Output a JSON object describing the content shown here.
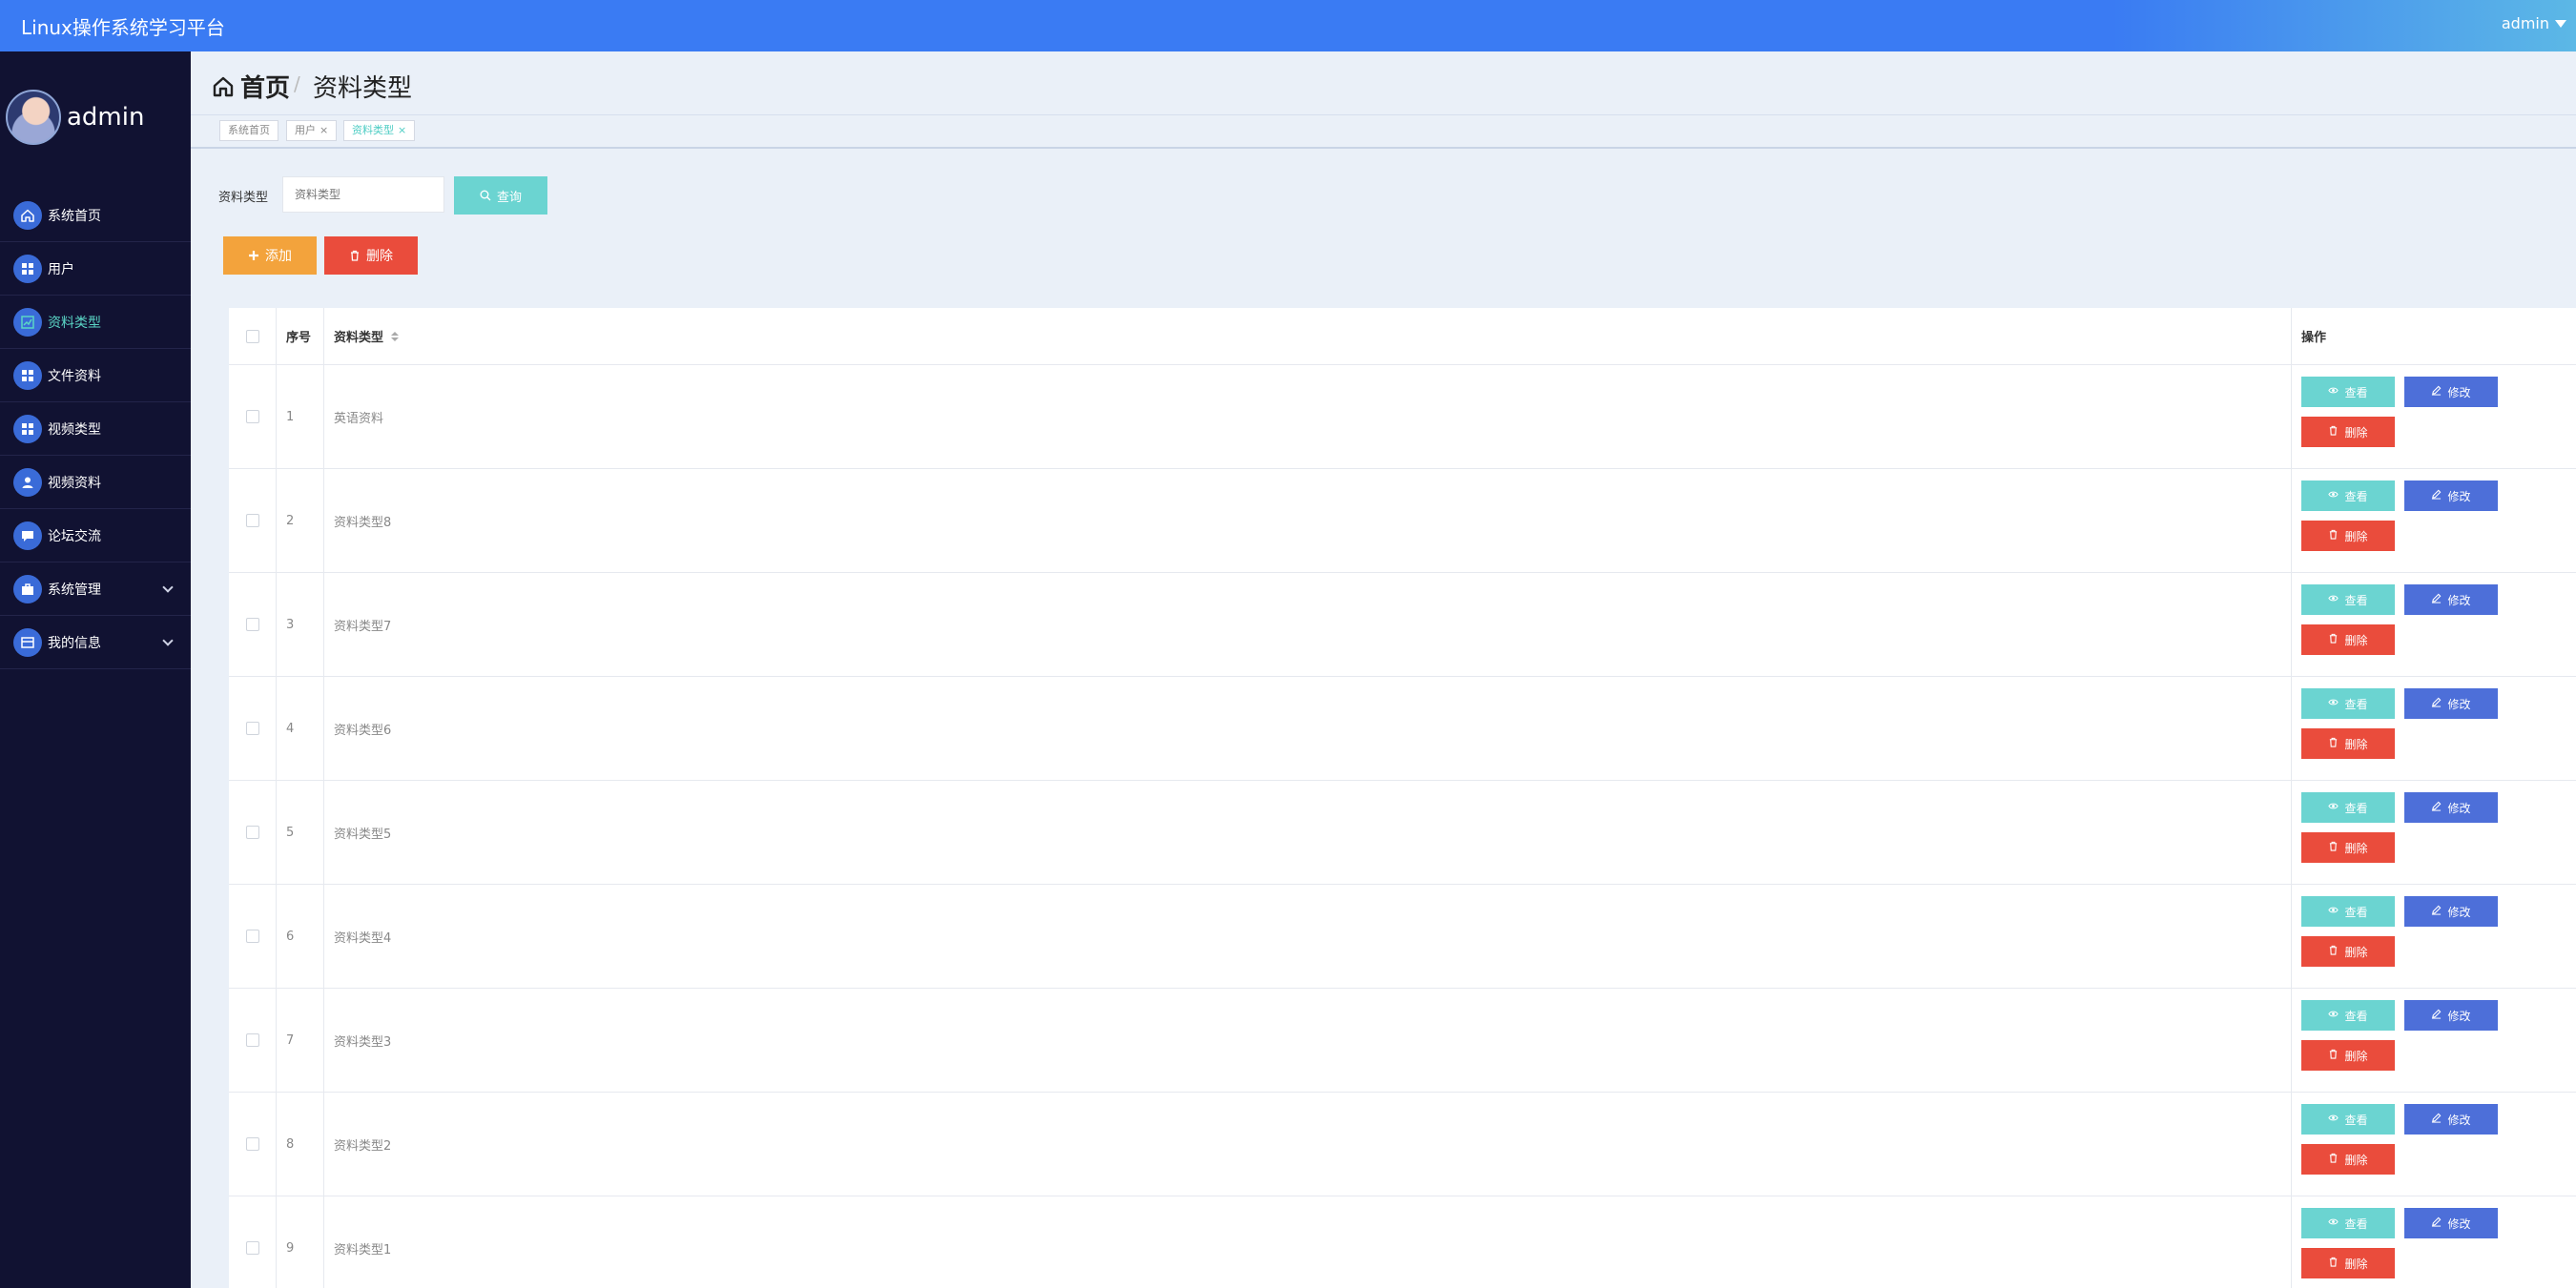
{
  "header": {
    "app_title": "Linux操作系统学习平台",
    "user": "admin"
  },
  "sidebar": {
    "profile_name": "admin",
    "items": [
      {
        "label": "系统首页",
        "icon": "home-icon"
      },
      {
        "label": "用户",
        "icon": "grid-icon"
      },
      {
        "label": "资料类型",
        "icon": "chart-icon",
        "active": true
      },
      {
        "label": "文件资料",
        "icon": "grid-icon"
      },
      {
        "label": "视频类型",
        "icon": "grid-icon"
      },
      {
        "label": "视频资料",
        "icon": "user-icon"
      },
      {
        "label": "论坛交流",
        "icon": "chat-icon"
      },
      {
        "label": "系统管理",
        "icon": "briefcase-icon",
        "expandable": true
      },
      {
        "label": "我的信息",
        "icon": "card-icon",
        "expandable": true
      }
    ]
  },
  "breadcrumb": {
    "home": "首页",
    "separator": "/",
    "current": "资料类型"
  },
  "tags": [
    {
      "label": "系统首页",
      "closable": false
    },
    {
      "label": "用户",
      "closable": true
    },
    {
      "label": "资料类型",
      "closable": true,
      "active": true
    }
  ],
  "search": {
    "label": "资料类型",
    "placeholder": "资料类型",
    "button": "查询"
  },
  "actions": {
    "add": "添加",
    "delete": "删除"
  },
  "table": {
    "columns": {
      "index": "序号",
      "name": "资料类型",
      "ops": "操作"
    },
    "row_buttons": {
      "view": "查看",
      "edit": "修改",
      "delete": "删除"
    },
    "rows": [
      {
        "index": "1",
        "name": "英语资料"
      },
      {
        "index": "2",
        "name": "资料类型8"
      },
      {
        "index": "3",
        "name": "资料类型7"
      },
      {
        "index": "4",
        "name": "资料类型6"
      },
      {
        "index": "5",
        "name": "资料类型5"
      },
      {
        "index": "6",
        "name": "资料类型4"
      },
      {
        "index": "7",
        "name": "资料类型3"
      },
      {
        "index": "8",
        "name": "资料类型2"
      },
      {
        "index": "9",
        "name": "资料类型1"
      }
    ]
  },
  "colors": {
    "topbar": "#3a7bf3",
    "sidebar": "#111232",
    "accent": "#4ecdc4",
    "warning": "#f3a33c",
    "danger": "#ea4c3c",
    "edit": "#4d6fd9"
  }
}
